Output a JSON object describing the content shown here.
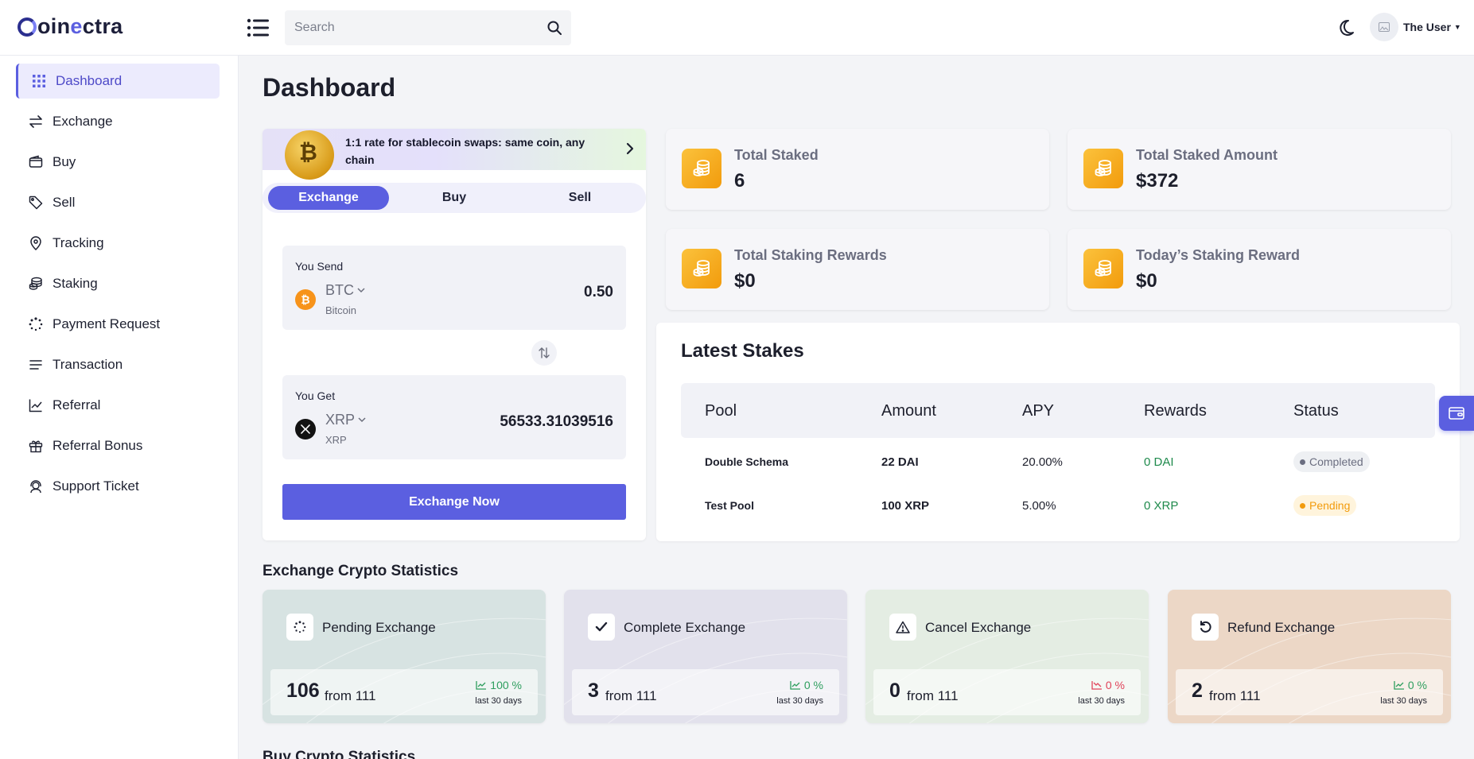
{
  "header": {
    "logo_prefix": "oin",
    "logo_accent": "e",
    "logo_suffix": "ctra",
    "search_placeholder": "Search",
    "user_name": "The User"
  },
  "sidebar": {
    "items": [
      {
        "label": "Dashboard",
        "icon": "grid-icon",
        "active": true
      },
      {
        "label": "Exchange",
        "icon": "arrows-exchange-icon"
      },
      {
        "label": "Buy",
        "icon": "wallet-icon"
      },
      {
        "label": "Sell",
        "icon": "tag-icon"
      },
      {
        "label": "Tracking",
        "icon": "location-pin-icon"
      },
      {
        "label": "Staking",
        "icon": "coins-icon"
      },
      {
        "label": "Payment Request",
        "icon": "loader-icon"
      },
      {
        "label": "Transaction",
        "icon": "list-icon"
      },
      {
        "label": "Referral",
        "icon": "chart-line-icon"
      },
      {
        "label": "Referral Bonus",
        "icon": "gift-icon"
      },
      {
        "label": "Support Ticket",
        "icon": "support-icon"
      }
    ]
  },
  "page_title": "Dashboard",
  "exchange": {
    "promo_text": "1:1 rate for stablecoin swaps: same coin, any chain",
    "promo_coin_symbol": "₿",
    "tabs": [
      "Exchange",
      "Buy",
      "Sell"
    ],
    "send_label": "You Send",
    "send_symbol": "BTC",
    "send_name": "Bitcoin",
    "send_amount": "0.50",
    "get_label": "You Get",
    "get_symbol": "XRP",
    "get_name": "XRP",
    "get_amount": "56533.31039516",
    "button": "Exchange Now"
  },
  "stats": [
    {
      "label": "Total Staked",
      "value": "6"
    },
    {
      "label": "Total Staked Amount",
      "value": "$372"
    },
    {
      "label": "Total Staking Rewards",
      "value": "$0"
    },
    {
      "label": "Today’s Staking Reward",
      "value": "$0"
    }
  ],
  "latest_stakes": {
    "title": "Latest Stakes",
    "columns": [
      "Pool",
      "Amount",
      "APY",
      "Rewards",
      "Status"
    ],
    "rows": [
      {
        "pool": "Double Schema",
        "amount": "22 DAI",
        "apy": "20.00%",
        "rewards": "0 DAI",
        "status": "Completed"
      },
      {
        "pool": "Test Pool",
        "amount": "100 XRP",
        "apy": "5.00%",
        "rewards": "0 XRP",
        "status": "Pending"
      }
    ]
  },
  "exchange_stats": {
    "title": "Exchange Crypto Statistics",
    "cards": [
      {
        "label": "Pending Exchange",
        "count": "106",
        "from": "from 111",
        "pct": "100 %",
        "trend": "up",
        "period": "last 30 days",
        "bg": "#d7e3e2",
        "icon": "loader-icon"
      },
      {
        "label": "Complete Exchange",
        "count": "3",
        "from": "from 111",
        "pct": "0 %",
        "trend": "up",
        "period": "last 30 days",
        "bg": "#e2e1ec",
        "icon": "check-icon"
      },
      {
        "label": "Cancel Exchange",
        "count": "0",
        "from": "from 111",
        "pct": "0 %",
        "trend": "down",
        "period": "last 30 days",
        "bg": "#e4ede3",
        "icon": "warning-icon"
      },
      {
        "label": "Refund Exchange",
        "count": "2",
        "from": "from 111",
        "pct": "0 %",
        "trend": "up",
        "period": "last 30 days",
        "bg": "#ecd7c6",
        "icon": "refund-icon"
      }
    ]
  },
  "next_section_title": "Buy Crypto Statistics",
  "colors": {
    "accent": "#5b5fe0",
    "accent_light": "#ecebfd",
    "stat_icon": "#f6a823",
    "positive": "#2e9e5e",
    "negative": "#e0435a",
    "pending": "#f29b0c"
  }
}
